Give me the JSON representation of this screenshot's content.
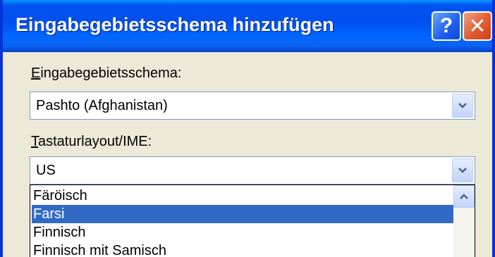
{
  "dialog": {
    "title": "Eingabegebietsschema hinzufügen",
    "help_symbol": "?",
    "close_symbol": "✕"
  },
  "locale": {
    "label_first": "E",
    "label_rest": "ingabegebietsschema:",
    "selected_value": "Pashto (Afghanistan)"
  },
  "keyboard": {
    "label_first": "T",
    "label_rest": "astaturlayout/IME:",
    "selected_value": "US",
    "options": [
      {
        "label": "Färöisch",
        "selected": false
      },
      {
        "label": "Farsi",
        "selected": true
      },
      {
        "label": "Finnisch",
        "selected": false
      },
      {
        "label": "Finnisch mit Samisch",
        "selected": false
      }
    ]
  },
  "colors": {
    "titlebar": "#0054e3",
    "selection": "#316ac5",
    "close": "#e25b32",
    "dialog_bg": "#ece9d8"
  },
  "icons": {
    "help": "help-icon",
    "close": "close-icon",
    "dropdown": "chevron-down-icon",
    "scroll_up": "chevron-up-icon"
  }
}
